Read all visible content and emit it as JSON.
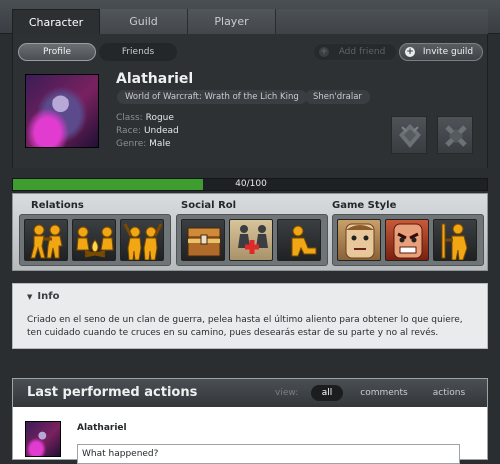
{
  "tabs": [
    {
      "label": "Character"
    },
    {
      "label": "Guild"
    },
    {
      "label": "Player"
    }
  ],
  "subnav": {
    "profile": "Profile",
    "friends": "Friends",
    "add_friend": "Add friend",
    "invite_guild": "Invite guild"
  },
  "character": {
    "name": "Alathariel",
    "game": "World of Warcraft: Wrath of the Lich King",
    "realm": "Shen'dralar",
    "class_label": "Class:",
    "class": "Rogue",
    "race_label": "Race:",
    "race": "Undead",
    "genre_label": "Genre:",
    "genre": "Male"
  },
  "progress": {
    "text": "40/100",
    "value": 40,
    "max": 100,
    "color": "#3d9e2f"
  },
  "traits": {
    "relations": {
      "title": "Relations",
      "icons": [
        "group-hug-icon",
        "campfire-icon",
        "cheer-icon"
      ]
    },
    "social_rol": {
      "title": "Social Rol",
      "icons": [
        "treasure-chest-icon",
        "chess-heal-icon",
        "seated-figure-icon"
      ]
    },
    "game_style": {
      "title": "Game Style",
      "icons": [
        "calm-face-icon",
        "angry-face-icon",
        "warrior-icon"
      ]
    }
  },
  "info": {
    "title": "Info",
    "text": "Criado en el seno de un clan de guerra, pelea hasta el último aliento para obtener lo que quiere, ten cuidado cuando te cruces en su camino, pues desearás estar de su parte y no al revés."
  },
  "actions": {
    "title": "Last performed actions",
    "view_label": "view:",
    "filters": [
      "all",
      "comments",
      "actions"
    ],
    "post_name": "Alathariel",
    "post_placeholder": "What happened?"
  }
}
